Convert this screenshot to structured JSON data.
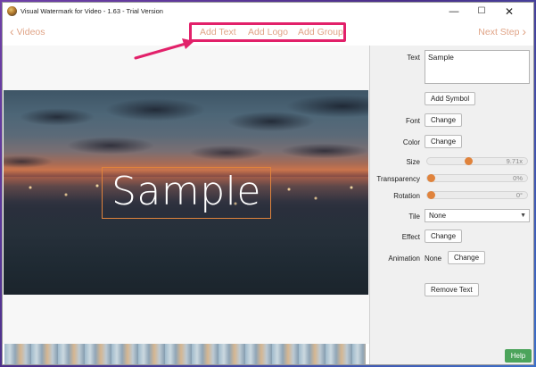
{
  "window": {
    "title": "Visual Watermark for Video - 1.63 - Trial Version",
    "controls": {
      "minimize": "—",
      "maximize": "☐",
      "close": "✕"
    }
  },
  "nav": {
    "back_label": "Videos",
    "back_chevron": "‹",
    "next_label": "Next Step",
    "next_chevron": "›",
    "add_text": "Add Text",
    "add_logo": "Add Logo",
    "add_group": "Add Group",
    "accent_color": "#e0a487",
    "highlight_color": "#e2216a"
  },
  "preview": {
    "watermark_text": "Sample"
  },
  "panel": {
    "text_label": "Text",
    "text_value": "Sample",
    "add_symbol": "Add Symbol",
    "font_label": "Font",
    "font_button": "Change",
    "color_label": "Color",
    "color_button": "Change",
    "size_label": "Size",
    "size_value": "9.71x",
    "size_level": 0.41,
    "transparency_label": "Transparency",
    "transparency_value": "0%",
    "transparency_level": 0,
    "rotation_label": "Rotation",
    "rotation_value": "0°",
    "rotation_level": 0,
    "tile_label": "Tile",
    "tile_value": "None",
    "tile_caret": "▼",
    "effect_label": "Effect",
    "effect_button": "Change",
    "animation_label": "Animation",
    "animation_value": "None",
    "animation_button": "Change",
    "remove_text": "Remove Text",
    "slider_color": "#e0833c"
  },
  "help": {
    "label": "Help",
    "color": "#4ca45b"
  }
}
